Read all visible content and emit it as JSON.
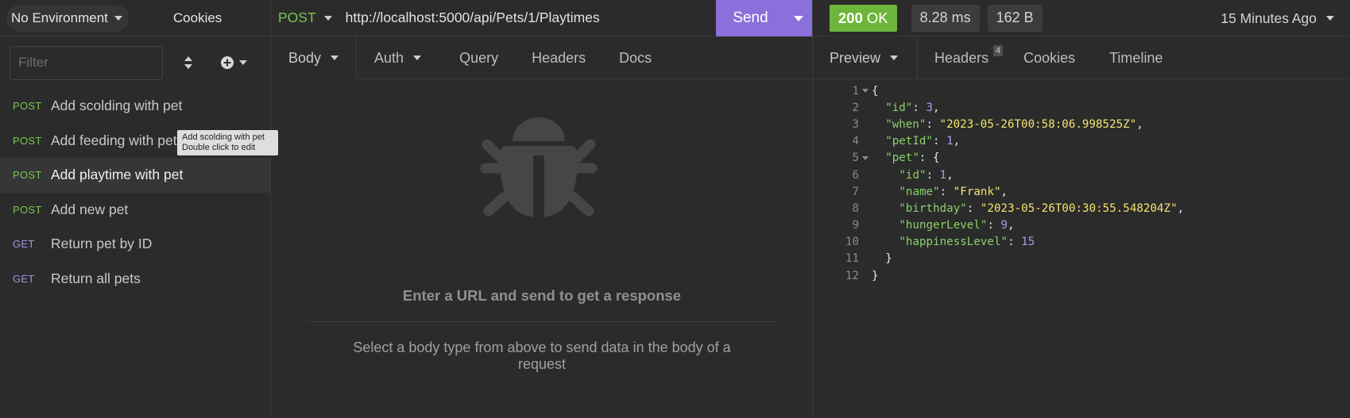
{
  "sidebar": {
    "environment_label": "No Environment",
    "cookies_label": "Cookies",
    "filter_placeholder": "Filter",
    "requests": [
      {
        "method": "POST",
        "name": "Add scolding with pet"
      },
      {
        "method": "POST",
        "name": "Add feeding with pet"
      },
      {
        "method": "POST",
        "name": "Add playtime with pet",
        "active": true
      },
      {
        "method": "POST",
        "name": "Add new pet"
      },
      {
        "method": "GET",
        "name": "Return pet by ID"
      },
      {
        "method": "GET",
        "name": "Return all pets"
      }
    ],
    "tooltip": {
      "line1": "Add scolding with pet",
      "line2": "Double click to edit"
    }
  },
  "request": {
    "method": "POST",
    "url": "http://localhost:5000/api/Pets/1/Playtimes",
    "send_label": "Send",
    "tabs": [
      {
        "label": "Body",
        "dropdown": true
      },
      {
        "label": "Auth",
        "dropdown": true
      },
      {
        "label": "Query"
      },
      {
        "label": "Headers"
      },
      {
        "label": "Docs"
      }
    ],
    "empty_title": "Enter a URL and send to get a response",
    "empty_subtitle": "Select a body type from above to send data in the body of a request"
  },
  "response": {
    "status": {
      "code": "200",
      "text": "OK"
    },
    "time": "8.28 ms",
    "size": "162 B",
    "time_ago": "15 Minutes Ago",
    "tabs": [
      {
        "label": "Preview",
        "dropdown": true
      },
      {
        "label": "Headers",
        "count": "4"
      },
      {
        "label": "Cookies"
      },
      {
        "label": "Timeline"
      }
    ],
    "body_lines": [
      {
        "n": "1",
        "fold": true,
        "indent": 0,
        "parts": [
          [
            "p",
            "{"
          ]
        ]
      },
      {
        "n": "2",
        "indent": 1,
        "parts": [
          [
            "k",
            "\"id\""
          ],
          [
            "p",
            ": "
          ],
          [
            "n",
            "3"
          ],
          [
            "p",
            ","
          ]
        ]
      },
      {
        "n": "3",
        "indent": 1,
        "parts": [
          [
            "k",
            "\"when\""
          ],
          [
            "p",
            ": "
          ],
          [
            "s",
            "\"2023-05-26T00:58:06.998525Z\""
          ],
          [
            "p",
            ","
          ]
        ]
      },
      {
        "n": "4",
        "indent": 1,
        "parts": [
          [
            "k",
            "\"petId\""
          ],
          [
            "p",
            ": "
          ],
          [
            "n",
            "1"
          ],
          [
            "p",
            ","
          ]
        ]
      },
      {
        "n": "5",
        "fold": true,
        "indent": 1,
        "parts": [
          [
            "k",
            "\"pet\""
          ],
          [
            "p",
            ": {"
          ]
        ]
      },
      {
        "n": "6",
        "indent": 2,
        "parts": [
          [
            "k",
            "\"id\""
          ],
          [
            "p",
            ": "
          ],
          [
            "n",
            "1"
          ],
          [
            "p",
            ","
          ]
        ]
      },
      {
        "n": "7",
        "indent": 2,
        "parts": [
          [
            "k",
            "\"name\""
          ],
          [
            "p",
            ": "
          ],
          [
            "s",
            "\"Frank\""
          ],
          [
            "p",
            ","
          ]
        ]
      },
      {
        "n": "8",
        "indent": 2,
        "parts": [
          [
            "k",
            "\"birthday\""
          ],
          [
            "p",
            ": "
          ],
          [
            "s",
            "\"2023-05-26T00:30:55.548204Z\""
          ],
          [
            "p",
            ","
          ]
        ]
      },
      {
        "n": "9",
        "indent": 2,
        "parts": [
          [
            "k",
            "\"hungerLevel\""
          ],
          [
            "p",
            ": "
          ],
          [
            "n",
            "9"
          ],
          [
            "p",
            ","
          ]
        ]
      },
      {
        "n": "10",
        "indent": 2,
        "parts": [
          [
            "k",
            "\"happinessLevel\""
          ],
          [
            "p",
            ": "
          ],
          [
            "n",
            "15"
          ]
        ]
      },
      {
        "n": "11",
        "indent": 1,
        "parts": [
          [
            "p",
            "}"
          ]
        ]
      },
      {
        "n": "12",
        "indent": 0,
        "parts": [
          [
            "p",
            "}"
          ]
        ]
      }
    ]
  },
  "colors": {
    "accent": "#8b6fdb",
    "post": "#7ac74f",
    "get": "#a393e8",
    "status_ok": "#6eb53c"
  }
}
